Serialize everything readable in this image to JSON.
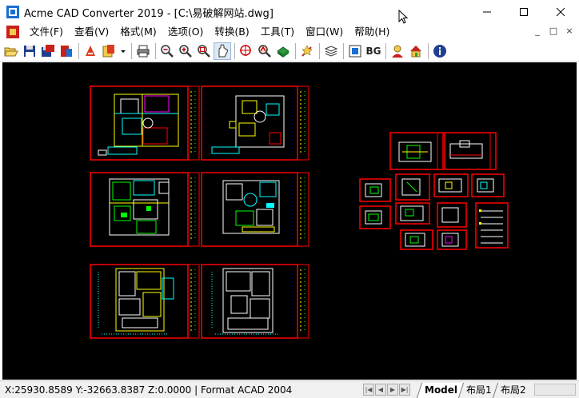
{
  "window": {
    "title": "Acme CAD Converter 2019 - [C:\\易破解网站.dwg]",
    "controls": [
      "minimize",
      "maximize",
      "close"
    ]
  },
  "menu": {
    "items": [
      {
        "label": "文件(F)"
      },
      {
        "label": "查看(V)"
      },
      {
        "label": "格式(M)"
      },
      {
        "label": "选项(O)"
      },
      {
        "label": "转换(B)"
      },
      {
        "label": "工具(T)"
      },
      {
        "label": "窗口(W)"
      },
      {
        "label": "帮助(H)"
      }
    ],
    "mdi_controls": [
      "_",
      "□",
      "×"
    ]
  },
  "toolbar": {
    "icons": [
      "open-icon",
      "save-icon",
      "save-as-icon",
      "convert-icon",
      "export-pdf-icon",
      "layout-icon",
      "dropdown-arrow-icon",
      "print-icon",
      "zoom-out-icon",
      "zoom-in-icon",
      "zoom-window-icon",
      "pan-icon",
      "zoom-extent-icon",
      "measure-icon",
      "3d-view-icon",
      "mark-icon",
      "layers-icon",
      "fit-screen-icon",
      "bg-toggle",
      "user-icon",
      "home-icon",
      "info-icon"
    ],
    "bg_label": "BG"
  },
  "status": {
    "coordinates": "X:25930.8589 Y:-32663.8387 Z:0.0000",
    "format": "Format ACAD 2004",
    "text": "X:25930.8589 Y:-32663.8387 Z:0.0000 | Format ACAD 2004"
  },
  "tabs": [
    {
      "label": "Model",
      "active": true
    },
    {
      "label": "布局1",
      "active": false
    },
    {
      "label": "布局2",
      "active": false
    }
  ],
  "colors": {
    "canvas_bg": "#000000",
    "frame_red": "#ff0000",
    "line_yellow": "#ffff00",
    "line_cyan": "#00ffff",
    "line_green": "#00ff00",
    "line_white": "#ffffff",
    "line_magenta": "#ff00ff"
  }
}
